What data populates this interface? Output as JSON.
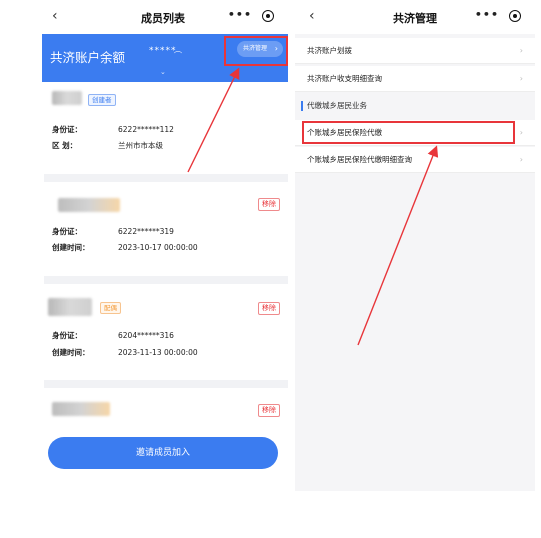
{
  "left": {
    "title": "成员列表",
    "back": "‹",
    "more": "•••",
    "balance_label": "共济账户余额",
    "balance_value": "*****",
    "manage_button": "共济管理",
    "members": [
      {
        "tag": "创建者",
        "fields": [
          {
            "k": "身份证：",
            "v": "6222******112"
          },
          {
            "k": "区  划：",
            "v": "兰州市市本级"
          }
        ]
      },
      {
        "remove": "移除",
        "fields": [
          {
            "k": "身份证：",
            "v": "6222******319"
          },
          {
            "k": "创建时间：",
            "v": "2023-10-17 00:00:00"
          }
        ]
      },
      {
        "tag": "配偶",
        "remove": "移除",
        "fields": [
          {
            "k": "身份证：",
            "v": "6204******316"
          },
          {
            "k": "创建时间：",
            "v": "2023-11-13 00:00:00"
          }
        ]
      },
      {
        "remove": "移除"
      }
    ],
    "invite_button": "邀请成员加入"
  },
  "right": {
    "title": "共济管理",
    "back": "‹",
    "more": "•••",
    "items_top": [
      "共济账户划拨",
      "共济账户收支明细查询"
    ],
    "section": "代缴城乡居民业务",
    "items_bottom": [
      "个账城乡居民保险代缴",
      "个账城乡居民保险代缴明细查询"
    ]
  },
  "colors": {
    "accent": "#3b7cf0",
    "highlight": "#e8353a",
    "arrow": "#e8353a"
  },
  "icons": [
    "back-chevron-icon",
    "more-dots-icon",
    "target-icon",
    "eye-icon",
    "chevron-right-icon",
    "arrow-annotation-icon"
  ]
}
